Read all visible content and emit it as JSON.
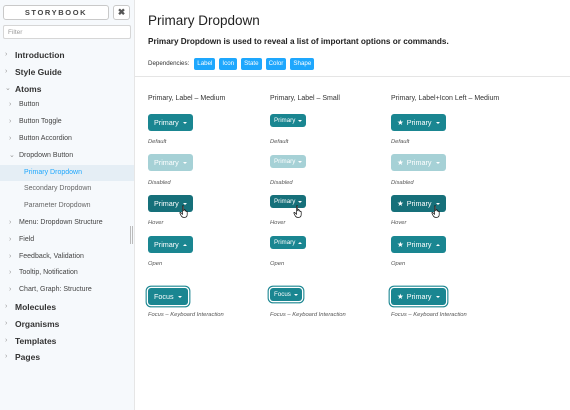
{
  "sidebar": {
    "title": "STORYBOOK",
    "close_label": "✖",
    "filter_placeholder": "Filter",
    "items": [
      {
        "label": "Introduction",
        "level": 0
      },
      {
        "label": "Style Guide",
        "level": 0
      },
      {
        "label": "Atoms",
        "level": 0,
        "expanded": true
      },
      {
        "label": "Button",
        "level": 1
      },
      {
        "label": "Button Toggle",
        "level": 1
      },
      {
        "label": "Button Accordion",
        "level": 1
      },
      {
        "label": "Dropdown Button",
        "level": 1,
        "expanded": true
      },
      {
        "label": "Primary Dropdown",
        "level": 2,
        "selected": true
      },
      {
        "label": "Secondary Dropdown",
        "level": 2
      },
      {
        "label": "Parameter Dropdown",
        "level": 2
      },
      {
        "label": "Menu: Dropdown Structure",
        "level": 1
      },
      {
        "label": "Field",
        "level": 1
      },
      {
        "label": "Feedback, Validation",
        "level": 1
      },
      {
        "label": "Tooltip, Notification",
        "level": 1
      },
      {
        "label": "Chart, Graph: Structure",
        "level": 1
      },
      {
        "label": "Molecules",
        "level": 0
      },
      {
        "label": "Organisms",
        "level": 0
      },
      {
        "label": "Templates",
        "level": 0
      },
      {
        "label": "Pages",
        "level": 0
      }
    ]
  },
  "main": {
    "title": "Primary Dropdown",
    "description": "Primary Dropdown is used to reveal a list of important options or commands.",
    "dependencies_label": "Dependencies:",
    "dependencies": [
      "Label",
      "Icon",
      "State",
      "Color",
      "Shape"
    ],
    "columns": [
      {
        "heading": "Primary, Label – Medium"
      },
      {
        "heading": "Primary, Label – Small"
      },
      {
        "heading": "Primary, Label+Icon Left – Medium"
      }
    ],
    "button_label": "Primary",
    "focus_label": "Focus",
    "states": {
      "default": "Default",
      "disabled": "Disabled",
      "hover": "Hover",
      "open": "Open",
      "focus": "Focus – Keyboard Interaction"
    }
  },
  "colors": {
    "accent": "#1a8691",
    "accent_disabled": "#a6d1d6",
    "badge": "#1ea7fd",
    "sidebar_bg": "#f6f9fc",
    "selected_text": "#1ea7fd"
  }
}
